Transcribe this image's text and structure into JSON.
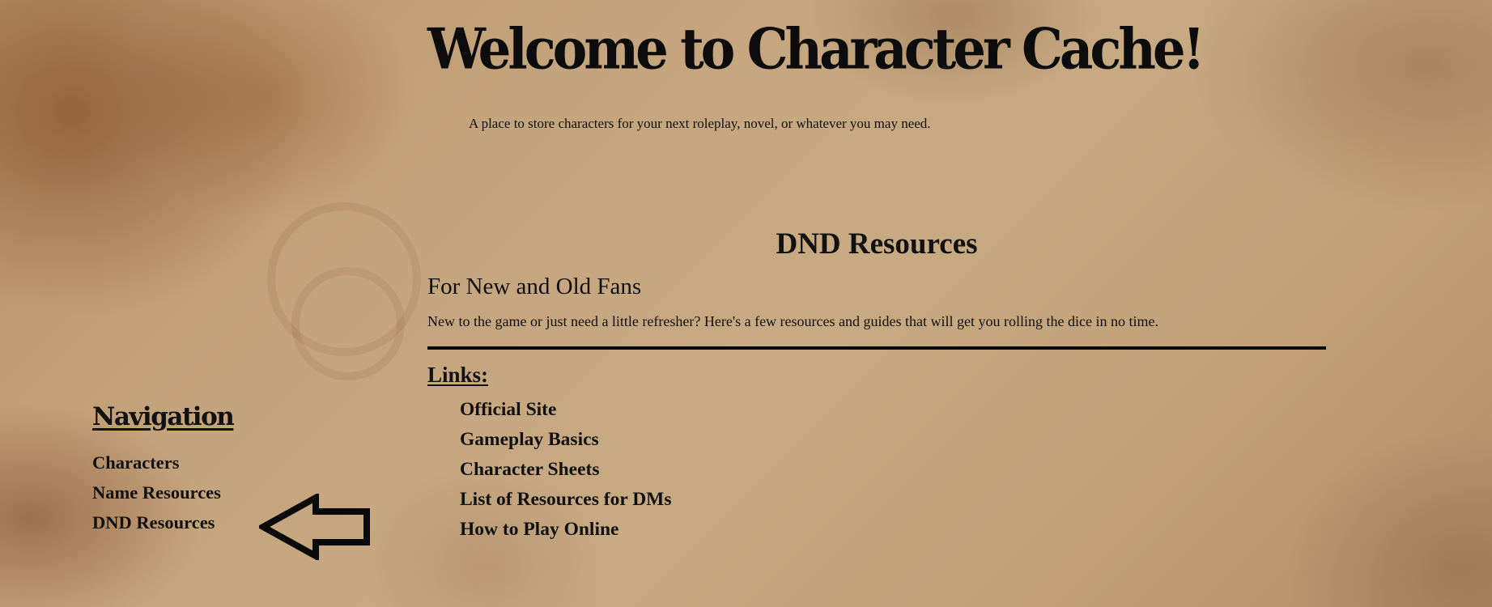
{
  "header": {
    "title": "Welcome to Character Cache!",
    "tagline": "A place to store characters for your next roleplay, novel, or whatever you may need."
  },
  "navigation": {
    "heading": "Navigation",
    "items": [
      {
        "label": "Characters"
      },
      {
        "label": "Name Resources"
      },
      {
        "label": "DND Resources"
      }
    ],
    "current_indicator_icon": "left-arrow-icon"
  },
  "main": {
    "section_title": "DND Resources",
    "subheading": "For New and Old Fans",
    "intro": "New to the game or just need a little refresher? Here's a few resources and guides that will get you rolling the dice in no time.",
    "links_label": "Links:",
    "links": [
      {
        "label": "Official Site"
      },
      {
        "label": "Gameplay Basics"
      },
      {
        "label": "Character Sheets"
      },
      {
        "label": "List of Resources for DMs"
      },
      {
        "label": "How to Play Online"
      }
    ]
  },
  "colors": {
    "parchment": "#c4a47c",
    "stain": "#78371a",
    "ink": "#0c0c0c"
  }
}
